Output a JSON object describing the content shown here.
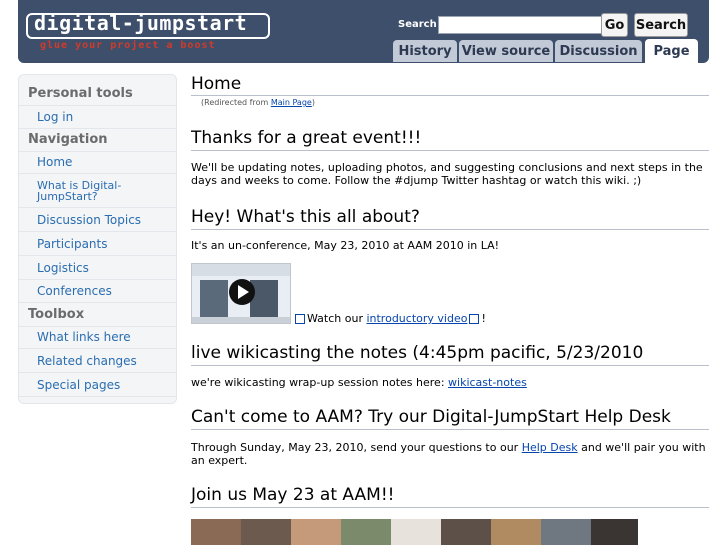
{
  "header": {
    "logo": "digital-jumpstart",
    "tagline": "glue your project a boost",
    "search_label": "Search",
    "search_value": "",
    "go_label": "Go",
    "search_button": "Search",
    "tabs": [
      "History",
      "View source",
      "Discussion",
      "Page"
    ],
    "active_tab": "Page"
  },
  "sidebar": {
    "personal_tools_title": "Personal tools",
    "personal_tools": [
      "Log in"
    ],
    "navigation_title": "Navigation",
    "navigation": [
      "Home",
      "What is Digital-",
      "JumpStart?",
      "Discussion Topics",
      "Participants",
      "Logistics",
      "Conferences"
    ],
    "toolbox_title": "Toolbox",
    "toolbox": [
      "What links here",
      "Related changes",
      "Special pages"
    ]
  },
  "content": {
    "page_title": "Home",
    "redirect_prefix": "(Redirected from ",
    "redirect_link": "Main Page",
    "redirect_suffix": ")",
    "sections": [
      {
        "heading": "Thanks for a great event!!!",
        "text": "We'll be updating notes, uploading photos, and suggesting conclusions and next steps in the days and weeks to come. Follow the #djump Twitter hashtag or watch this wiki.  ;)"
      },
      {
        "heading": "Hey! What's this all about?",
        "text": "It's an un-conference, May 23, 2010 at AAM 2010 in LA!"
      },
      {
        "heading": "live wikicasting the notes (4:45pm pacific, 5/23/2010",
        "text": "we're wikicasting wrap-up session notes here: ",
        "link": "wikicast-notes"
      },
      {
        "heading": "Can't come to AAM? Try our Digital-JumpStart Help Desk",
        "text_before": "Through Sunday, May 23, 2010, send your questions to our ",
        "link": "Help Desk",
        "text_after": " and we'll pair you with an expert."
      },
      {
        "heading": "Join us May 23 at AAM!!"
      }
    ],
    "video_prefix": "Watch our ",
    "video_link": "introductory video",
    "video_suffix": "!"
  },
  "colors": {
    "header_bg": "#3e4f6b",
    "tagline": "#d23a2a",
    "link": "#0645ad",
    "sidebar_link": "#2a6db0"
  }
}
